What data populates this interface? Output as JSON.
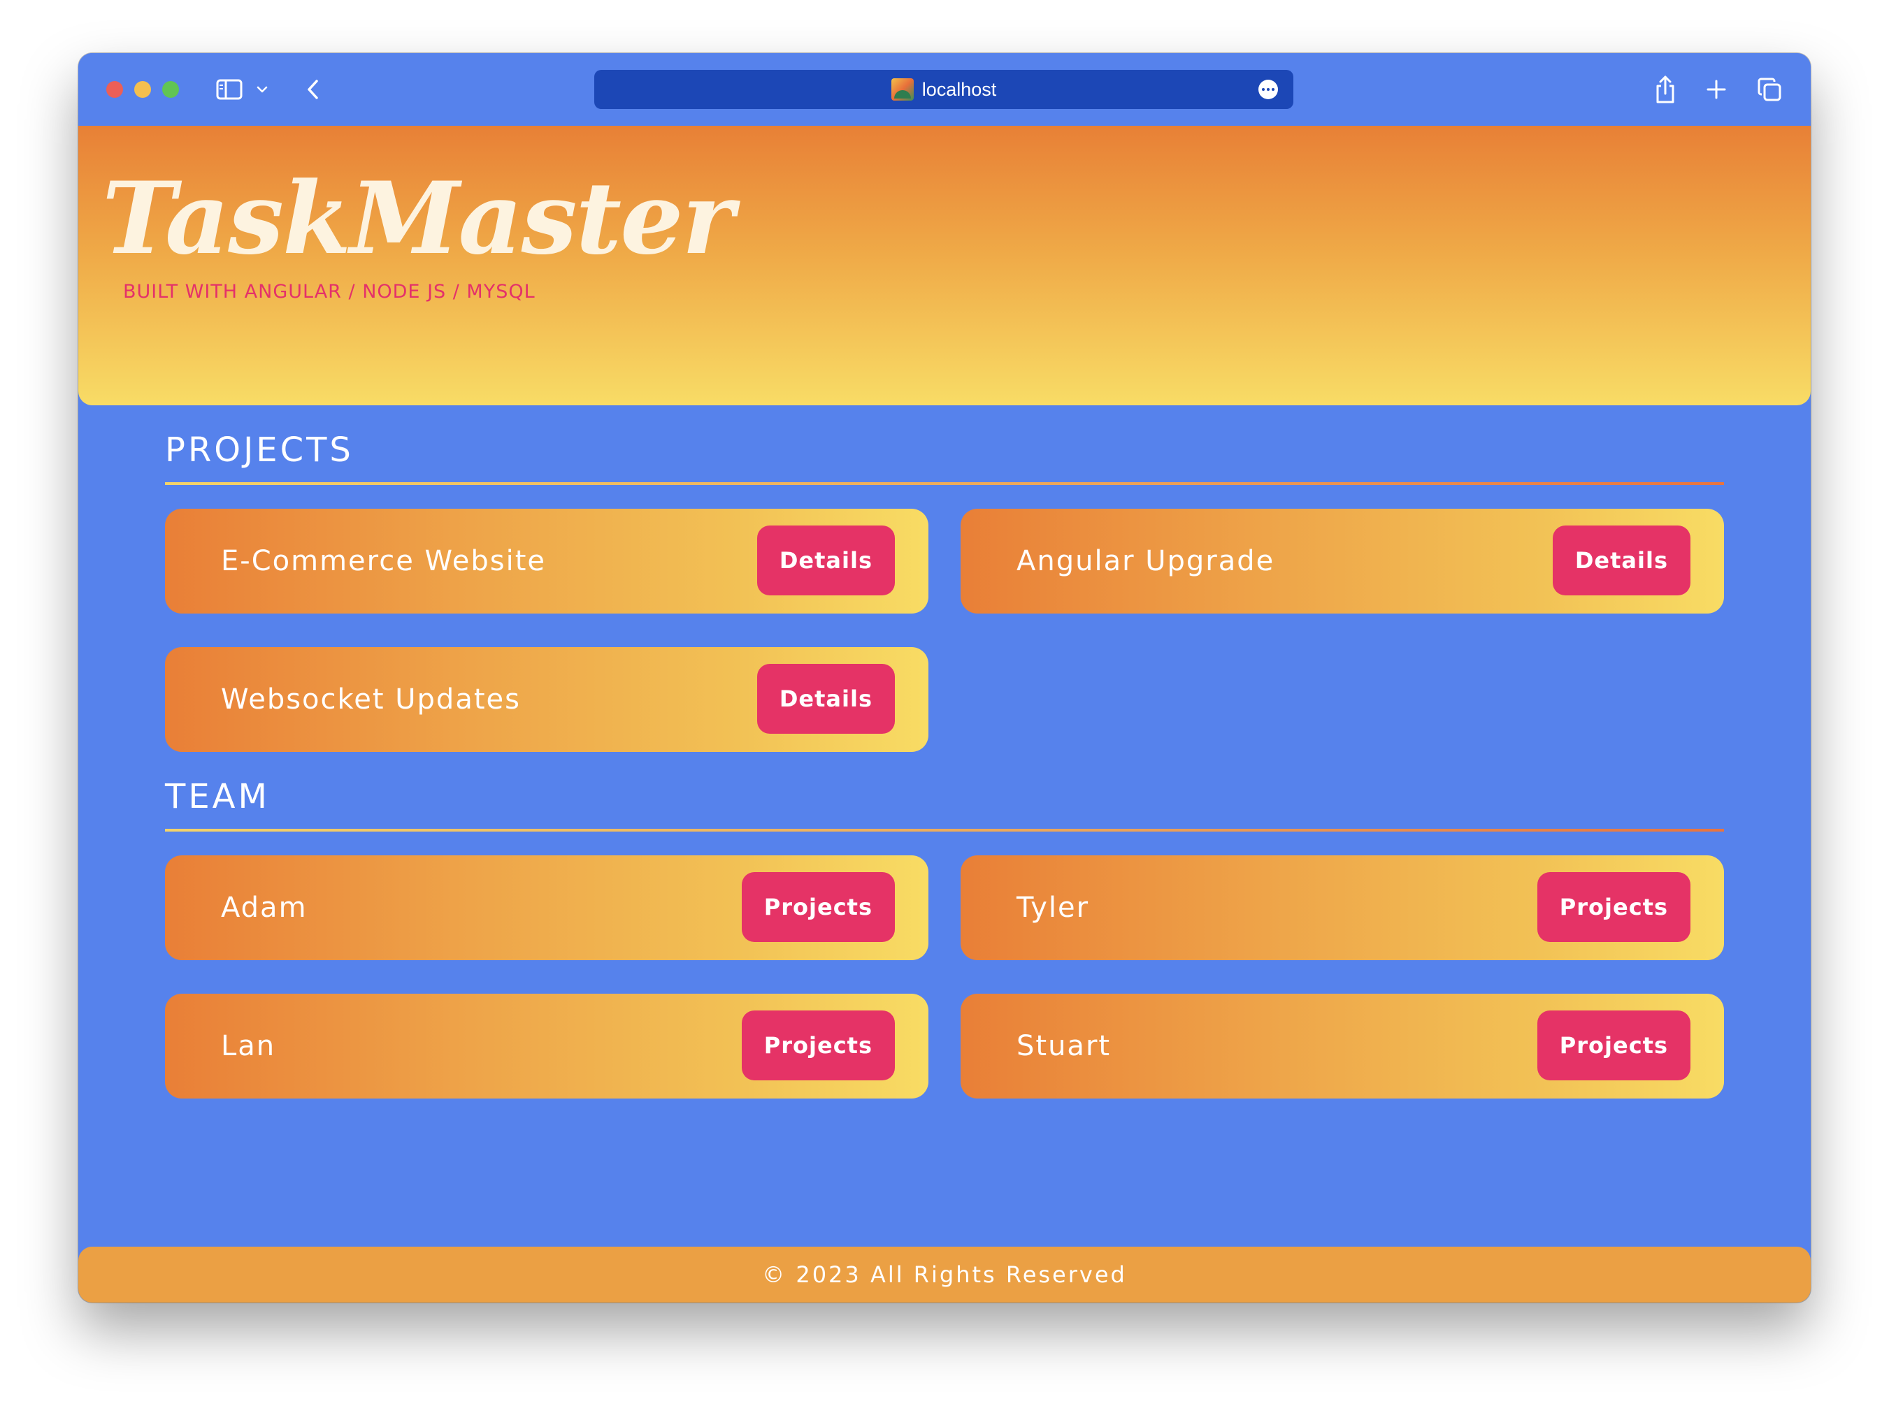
{
  "browser": {
    "url": "localhost",
    "favicon": "app-favicon",
    "toolbar_icons": [
      "sidebar-icon",
      "chevron-down-icon",
      "back-icon",
      "share-icon",
      "new-tab-icon",
      "tabs-overview-icon",
      "more-icon"
    ]
  },
  "header": {
    "brand": "TaskMaster",
    "tagline": "BUILT WITH ANGULAR / NODE JS / MYSQL"
  },
  "projects": {
    "title": "PROJECTS",
    "items": [
      {
        "name": "E-Commerce Website",
        "button": "Details"
      },
      {
        "name": "Angular Upgrade",
        "button": "Details"
      },
      {
        "name": "Websocket Updates",
        "button": "Details"
      }
    ]
  },
  "team": {
    "title": "TEAM",
    "members": [
      {
        "name": "Adam",
        "button": "Projects"
      },
      {
        "name": "Tyler",
        "button": "Projects"
      },
      {
        "name": "Lan",
        "button": "Projects"
      },
      {
        "name": "Stuart",
        "button": "Projects"
      }
    ]
  },
  "footer": {
    "text": "© 2023 All Rights Reserved"
  },
  "colors": {
    "page_background": "#5682ec",
    "url_bar": "#1c47b6",
    "header_gradient_top": "#e88036",
    "header_gradient_bottom": "#f8dc66",
    "tagline": "#e4316a",
    "button": "#e53366",
    "footer": "#eba044"
  }
}
